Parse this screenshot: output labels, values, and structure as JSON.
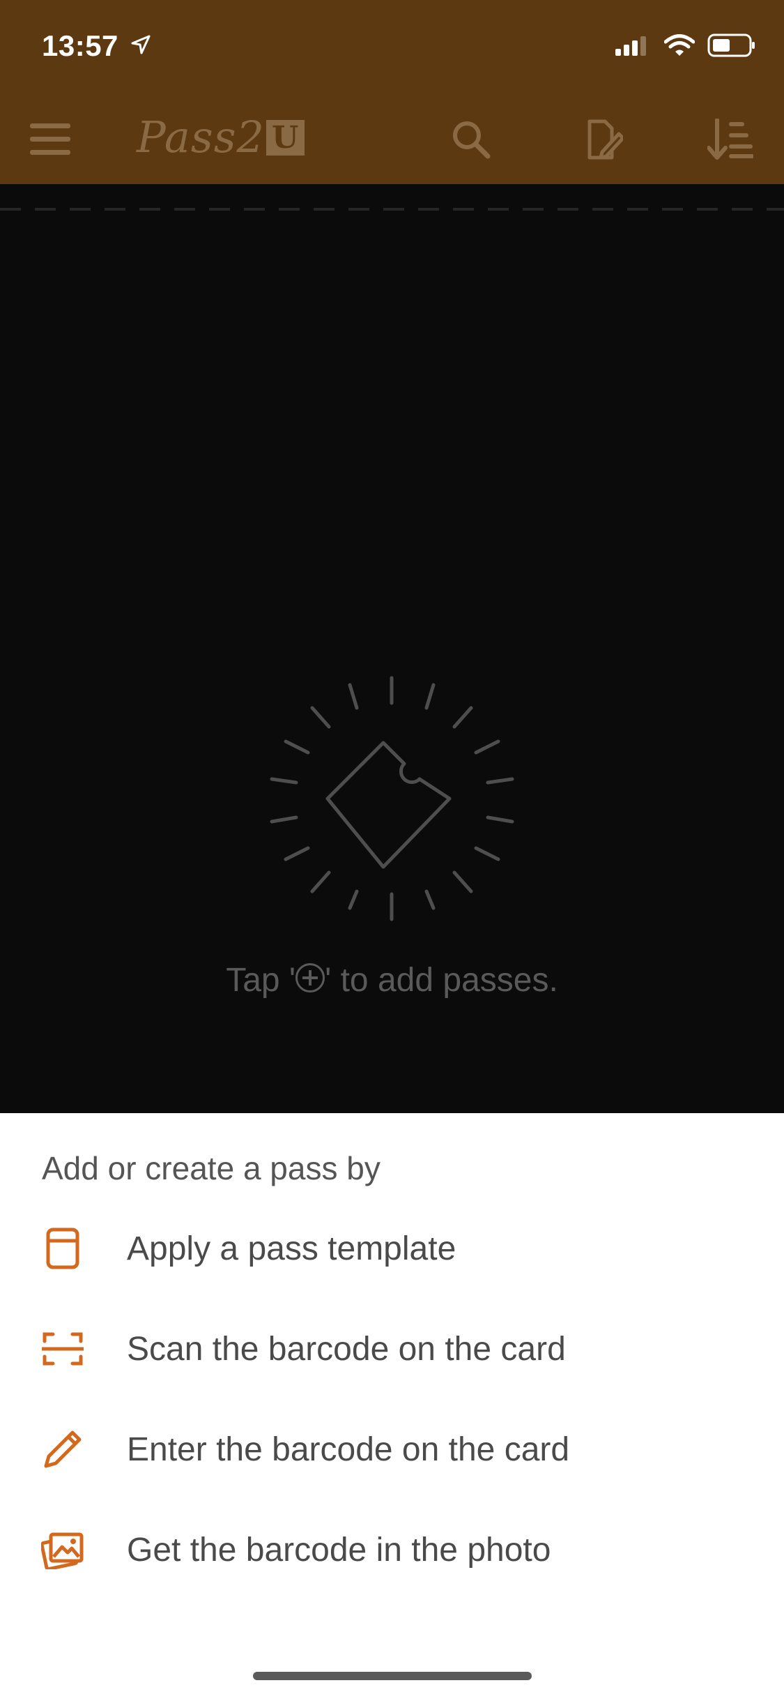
{
  "status_bar": {
    "time": "13:57",
    "icons": [
      "location-arrow-icon",
      "cellular-signal-icon",
      "wifi-icon",
      "battery-icon"
    ]
  },
  "header": {
    "brand_text": "Pass2",
    "brand_box": "U",
    "icons": [
      "hamburger-menu-icon",
      "search-icon",
      "edit-pass-icon",
      "sort-icon"
    ]
  },
  "empty_state": {
    "text_before": "Tap '",
    "text_after": "' to add passes.",
    "icon": "ticket-sparkle-icon"
  },
  "sheet": {
    "title": "Add or create a pass by",
    "options": [
      {
        "label": "Apply a pass template",
        "icon": "template-icon"
      },
      {
        "label": "Scan the barcode on the card",
        "icon": "scan-icon"
      },
      {
        "label": "Enter the barcode on the card",
        "icon": "pencil-icon"
      },
      {
        "label": "Get the barcode in the photo",
        "icon": "photo-icon"
      }
    ]
  },
  "colors": {
    "header_bg": "#5c3911",
    "accent": "#d2691e",
    "overlay_bg": "#0b0b0b",
    "sheet_bg": "#ffffff"
  }
}
